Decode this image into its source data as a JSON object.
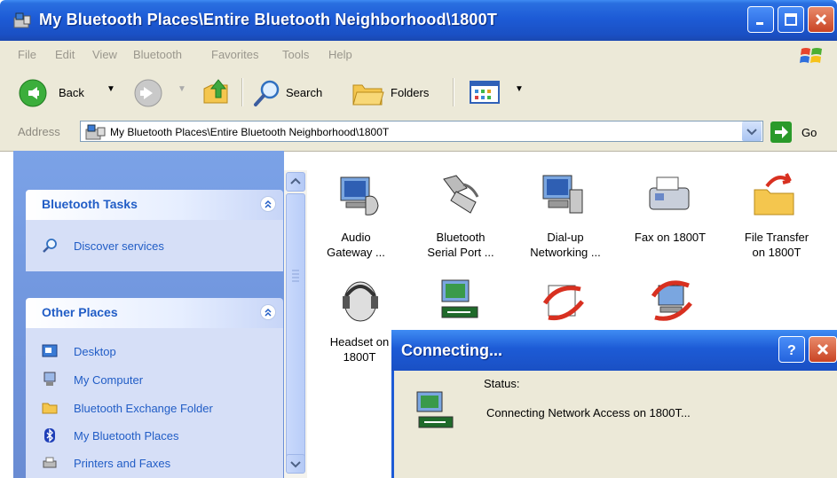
{
  "window": {
    "title": "My Bluetooth Places\\Entire Bluetooth Neighborhood\\1800T",
    "accent": "#1d5bd6"
  },
  "menu": [
    "File",
    "Edit",
    "View",
    "Bluetooth",
    "Favorites",
    "Tools",
    "Help"
  ],
  "toolbar": {
    "back_label": "Back",
    "search_label": "Search",
    "folders_label": "Folders"
  },
  "address": {
    "label": "Address",
    "value": "My Bluetooth Places\\Entire Bluetooth Neighborhood\\1800T",
    "go_label": "Go"
  },
  "tasks": {
    "title": "Bluetooth Tasks",
    "items": [
      "Discover services"
    ]
  },
  "other_places": {
    "title": "Other Places",
    "items": [
      "Desktop",
      "My Computer",
      "Bluetooth Exchange Folder",
      "My Bluetooth Places",
      "Printers and Faxes"
    ]
  },
  "services": [
    {
      "line1": "Audio",
      "line2": "Gateway ...",
      "icon": "audio-gateway-icon"
    },
    {
      "line1": "Bluetooth",
      "line2": "Serial Port ...",
      "icon": "serial-port-icon"
    },
    {
      "line1": "Dial-up",
      "line2": "Networking ...",
      "icon": "dialup-icon"
    },
    {
      "line1": "Fax on 1800T",
      "line2": "",
      "icon": "fax-icon"
    },
    {
      "line1": "File Transfer",
      "line2": "on 1800T",
      "icon": "file-transfer-icon"
    },
    {
      "line1": "Headset on",
      "line2": "1800T",
      "icon": "headset-icon"
    },
    {
      "line1": "",
      "line2": "",
      "icon": "network-access-icon"
    },
    {
      "line1": "",
      "line2": "",
      "icon": "object-push-icon"
    },
    {
      "line1": "",
      "line2": "",
      "icon": "pim-sync-icon"
    }
  ],
  "dialog": {
    "title": "Connecting...",
    "status_label": "Status:",
    "message": "Connecting Network Access on 1800T..."
  }
}
